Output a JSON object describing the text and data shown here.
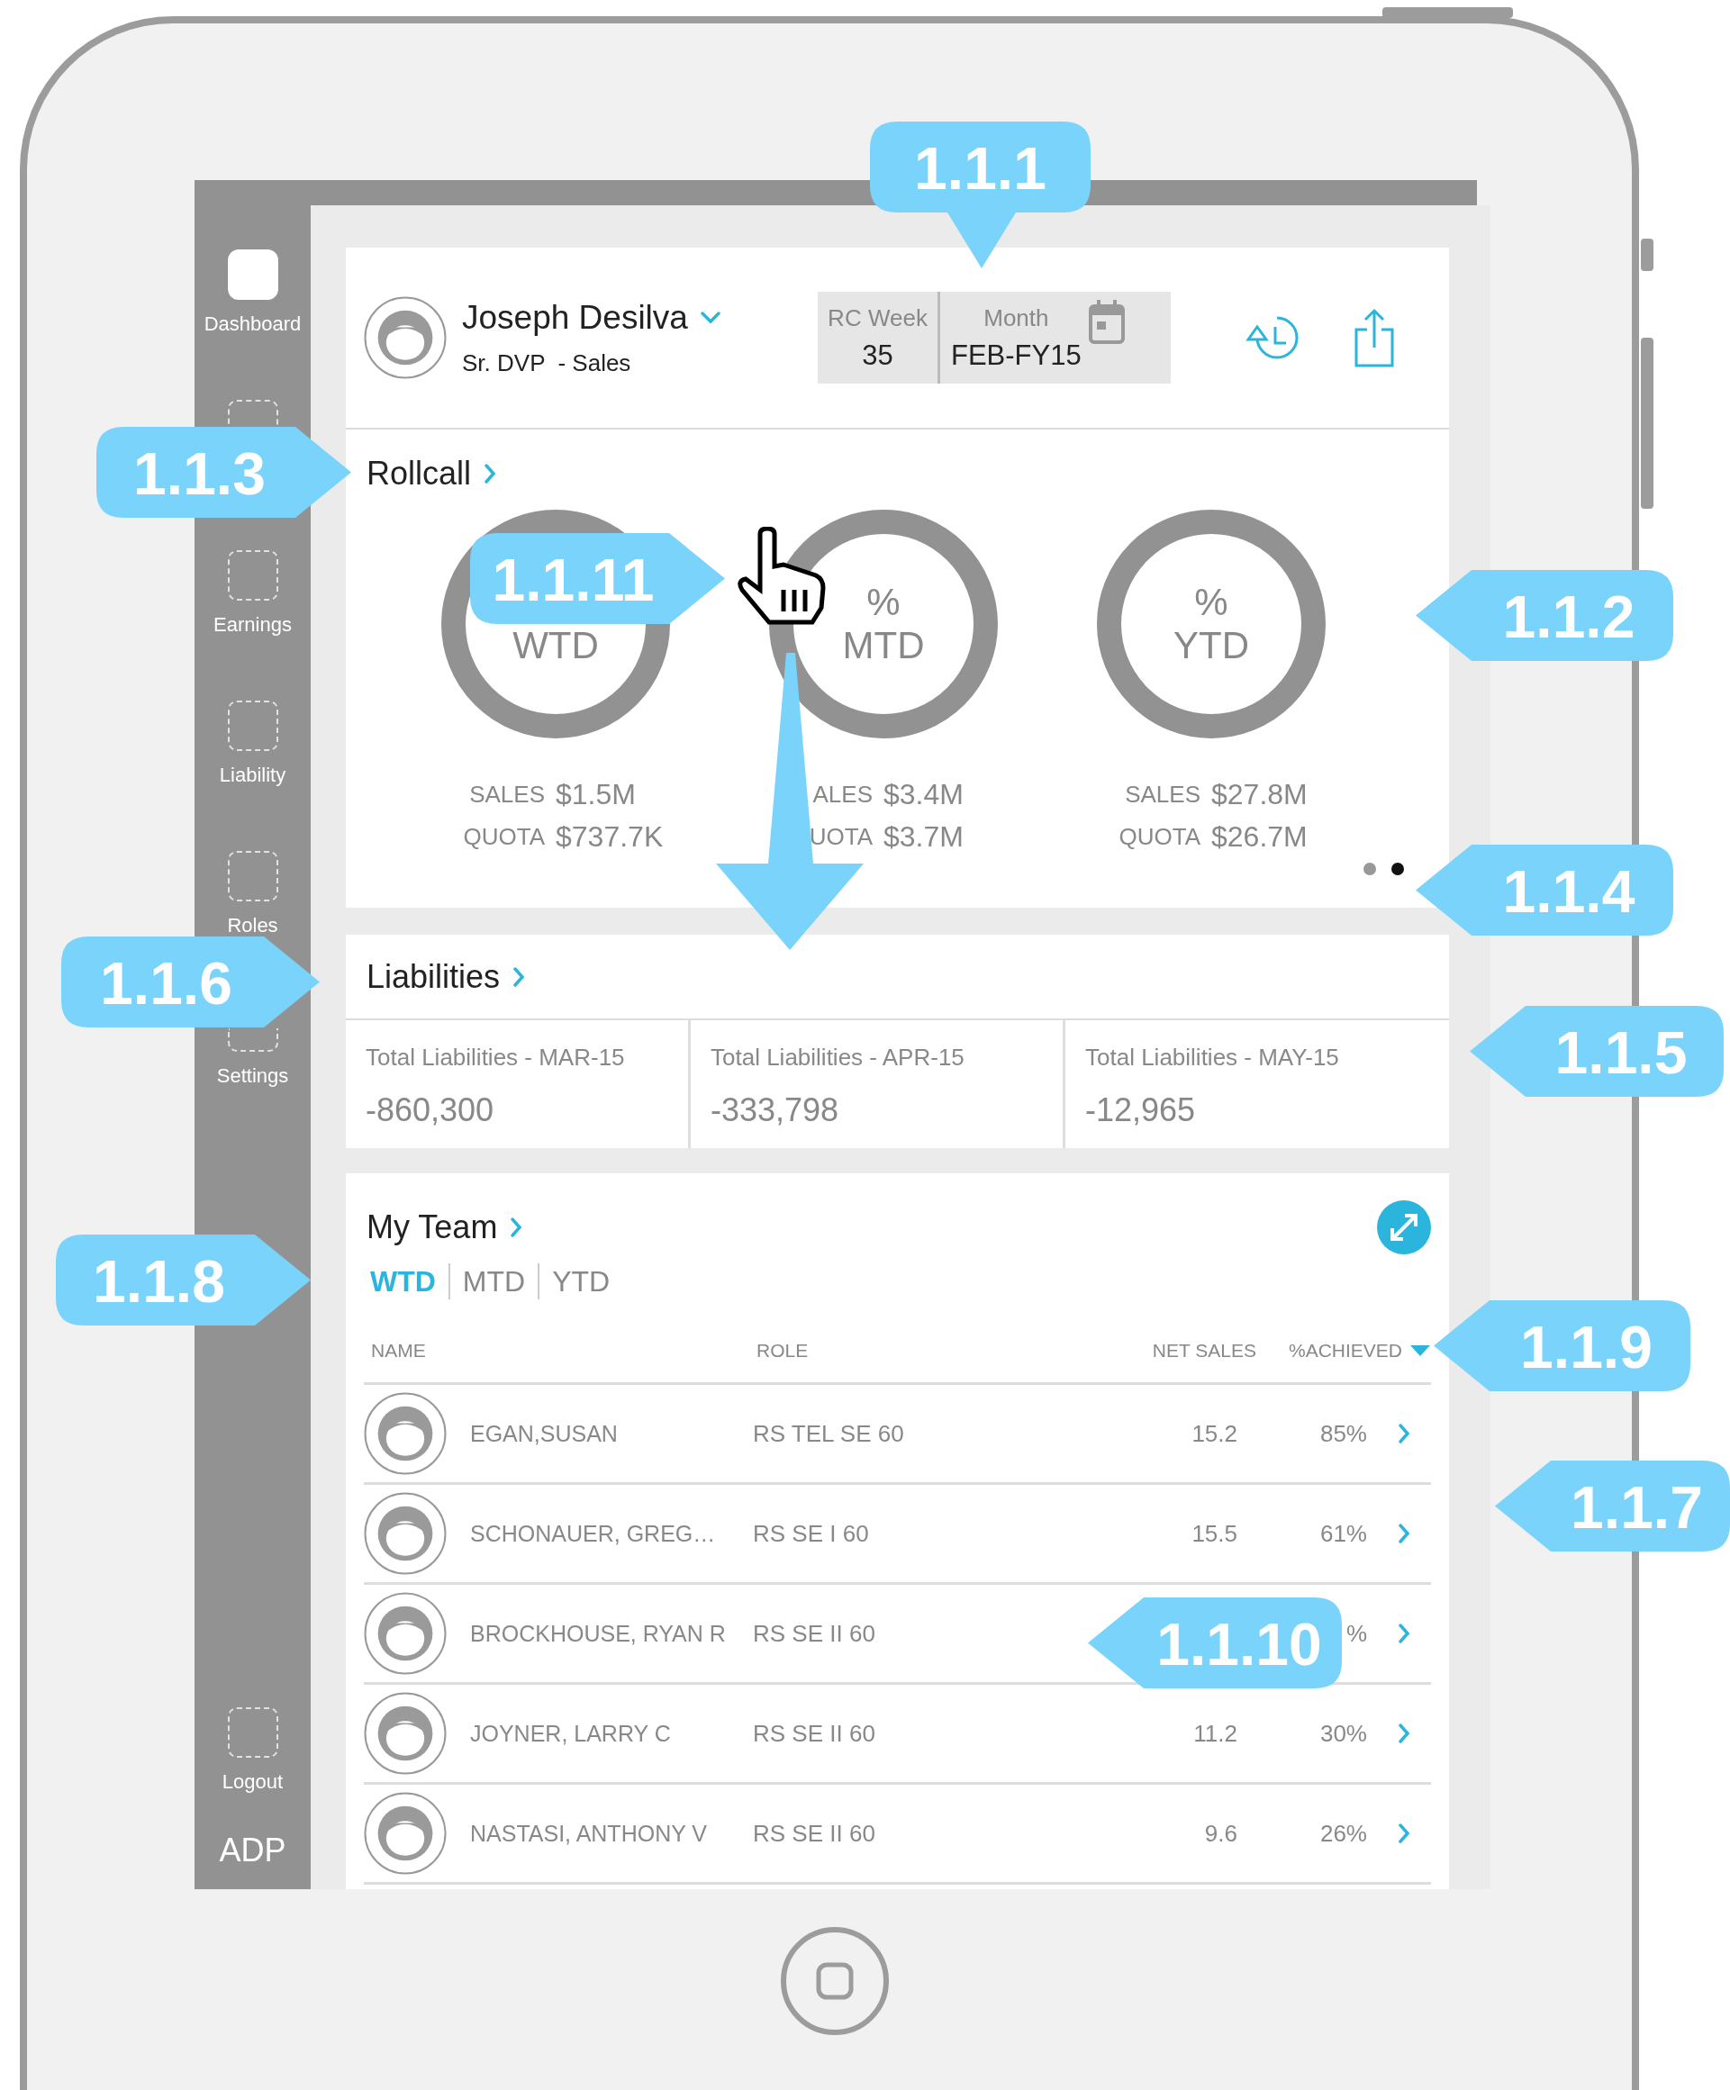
{
  "sidebar": {
    "items": [
      {
        "label": "Dashboard",
        "selected": true
      },
      {
        "selected": false
      },
      {
        "label": "Earnings",
        "selected": false
      },
      {
        "label": "Liability",
        "selected": false
      },
      {
        "label": "Roles",
        "selected": false
      },
      {
        "label": "Settings",
        "selected": false
      }
    ],
    "footer_items": [
      {
        "label": "Logout",
        "selected": false
      }
    ],
    "brand": "ADP"
  },
  "header": {
    "name": "Joseph Desilva",
    "title": "Sr. DVP  - Sales",
    "rc_week": {
      "label": "RC Week",
      "value": "35"
    },
    "month": {
      "label": "Month",
      "value": "FEB-FY15"
    }
  },
  "rollcall": {
    "title": "Rollcall",
    "gauges": [
      {
        "label": "WTD",
        "sales_label": "SALES",
        "sales": "$1.5M",
        "quota_label": "QUOTA",
        "quota": "$737.7K"
      },
      {
        "symbol": "%",
        "label": "MTD",
        "sales_label": "ALES",
        "sales": "$3.4M",
        "quota_label": "UOTA",
        "quota": "$3.7M"
      },
      {
        "symbol": "%",
        "label": "YTD",
        "sales_label": "SALES",
        "sales": "$27.8M",
        "quota_label": "QUOTA",
        "quota": "$26.7M"
      }
    ],
    "pager": [
      {
        "selected": false
      },
      {
        "selected": true
      }
    ]
  },
  "liabilities": {
    "title": "Liabilities",
    "items": [
      {
        "label": "Total Liabilities - MAR-15",
        "value": "-860,300"
      },
      {
        "label": "Total Liabilities - APR-15",
        "value": "-333,798"
      },
      {
        "label": "Total Liabilities - MAY-15",
        "value": "-12,965"
      }
    ]
  },
  "my_team": {
    "title": "My Team",
    "tabs": [
      {
        "label": "WTD",
        "selected": true
      },
      {
        "label": "MTD",
        "selected": false
      },
      {
        "label": "YTD",
        "selected": false
      }
    ],
    "columns": [
      "NAME",
      "ROLE",
      "NET SALES",
      "%ACHIEVED"
    ],
    "rows": [
      {
        "name": "EGAN,SUSAN",
        "role": "RS TEL SE 60",
        "net_sales": "15.2",
        "achieved": "85%"
      },
      {
        "name": "SCHONAUER, GREG…",
        "role": "RS SE I 60",
        "net_sales": "15.5",
        "achieved": "61%"
      },
      {
        "name": "BROCKHOUSE, RYAN R",
        "role": "RS SE II 60",
        "achieved": "%"
      },
      {
        "name": "JOYNER, LARRY C",
        "role": "RS SE II 60",
        "net_sales": "11.2",
        "achieved": "30%"
      },
      {
        "name": "NASTASI, ANTHONY V",
        "role": "RS SE II 60",
        "net_sales": "9.6",
        "achieved": "26%"
      }
    ]
  },
  "callouts": [
    {
      "label": "1.1.1"
    },
    {
      "label": "1.1.3"
    },
    {
      "label": "1.1.11"
    },
    {
      "label": "1.1.2"
    },
    {
      "label": "1.1.4"
    },
    {
      "label": "1.1.6"
    },
    {
      "label": "1.1.5"
    },
    {
      "label": "1.1.8"
    },
    {
      "label": "1.1.9"
    },
    {
      "label": "1.1.7"
    },
    {
      "label": "1.1.10"
    }
  ]
}
